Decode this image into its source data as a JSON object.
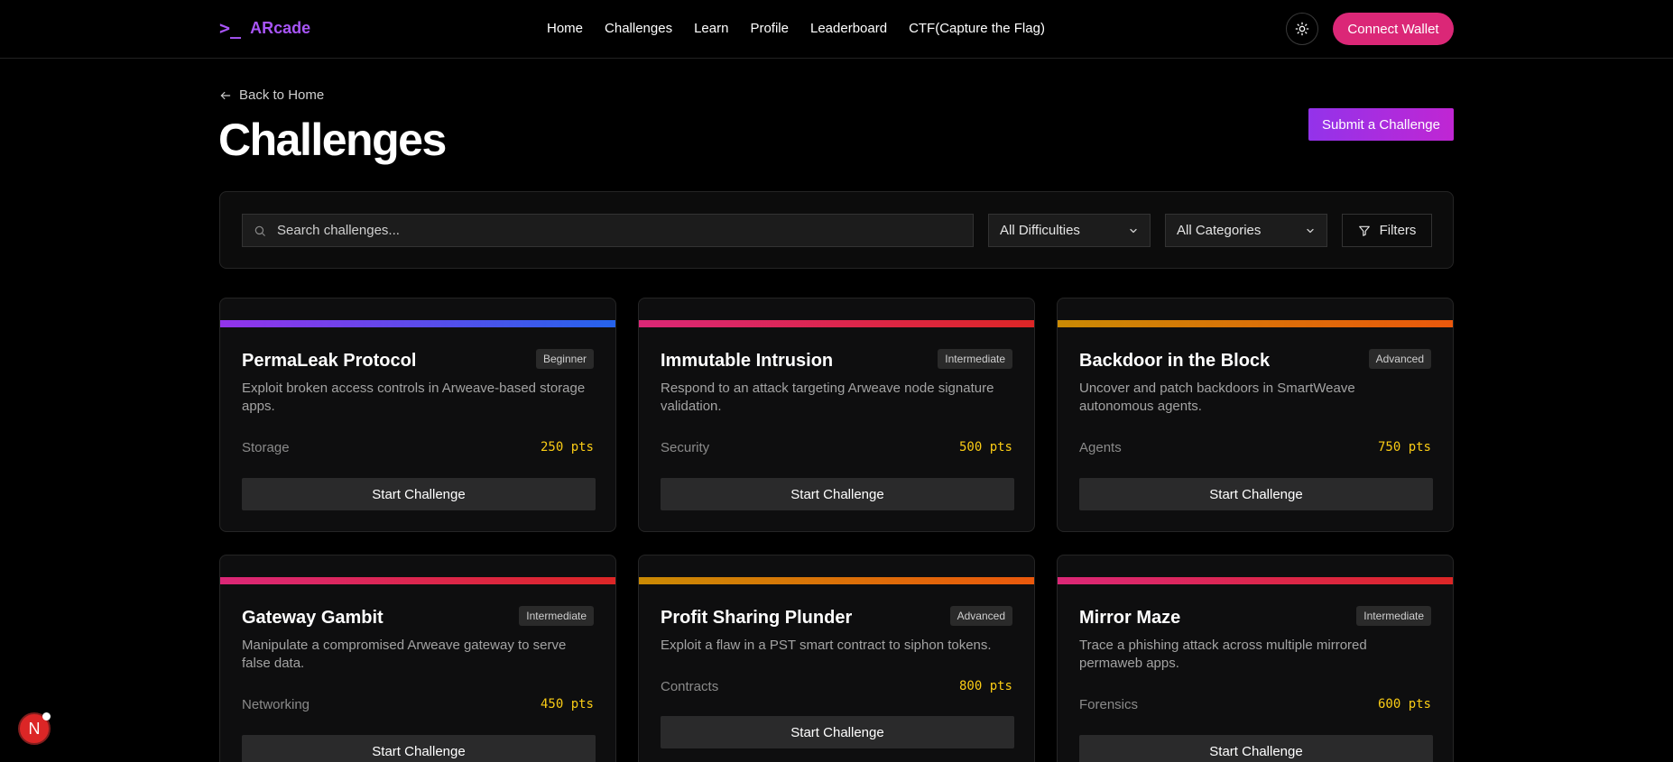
{
  "header": {
    "logo_icon": ">_",
    "logo_text": "ARcade",
    "nav": [
      "Home",
      "Challenges",
      "Learn",
      "Profile",
      "Leaderboard",
      "CTF(Capture the Flag)"
    ],
    "theme_icon": "sun-icon",
    "connect_wallet": "Connect Wallet"
  },
  "page": {
    "back_label": "Back to Home",
    "title": "Challenges",
    "submit_label": "Submit a Challenge"
  },
  "filters": {
    "search_placeholder": "Search challenges...",
    "difficulty": "All Difficulties",
    "category": "All Categories",
    "filters_label": "Filters"
  },
  "challenges": [
    {
      "title": "PermaLeak Protocol",
      "difficulty": "Beginner",
      "description": "Exploit broken access controls in Arweave-based storage apps.",
      "category": "Storage",
      "points": "250 pts",
      "button": "Start Challenge",
      "gradient": [
        "#9333ea",
        "#2563eb"
      ]
    },
    {
      "title": "Immutable Intrusion",
      "difficulty": "Intermediate",
      "description": "Respond to an attack targeting Arweave node signature validation.",
      "category": "Security",
      "points": "500 pts",
      "button": "Start Challenge",
      "gradient": [
        "#db2777",
        "#dc2626"
      ]
    },
    {
      "title": "Backdoor in the Block",
      "difficulty": "Advanced",
      "description": "Uncover and patch backdoors in SmartWeave autonomous agents.",
      "category": "Agents",
      "points": "750 pts",
      "button": "Start Challenge",
      "gradient": [
        "#ca8a04",
        "#ea580c"
      ]
    },
    {
      "title": "Gateway Gambit",
      "difficulty": "Intermediate",
      "description": "Manipulate a compromised Arweave gateway to serve false data.",
      "category": "Networking",
      "points": "450 pts",
      "button": "Start Challenge",
      "gradient": [
        "#db2777",
        "#dc2626"
      ]
    },
    {
      "title": "Profit Sharing Plunder",
      "difficulty": "Advanced",
      "description": "Exploit a flaw in a PST smart contract to siphon tokens.",
      "category": "Contracts",
      "points": "800 pts",
      "button": "Start Challenge",
      "gradient": [
        "#ca8a04",
        "#ea580c"
      ]
    },
    {
      "title": "Mirror Maze",
      "difficulty": "Intermediate",
      "description": "Trace a phishing attack across multiple mirrored permaweb apps.",
      "category": "Forensics",
      "points": "600 pts",
      "button": "Start Challenge",
      "gradient": [
        "#db2777",
        "#dc2626"
      ]
    }
  ],
  "fab": {
    "letter": "N"
  }
}
